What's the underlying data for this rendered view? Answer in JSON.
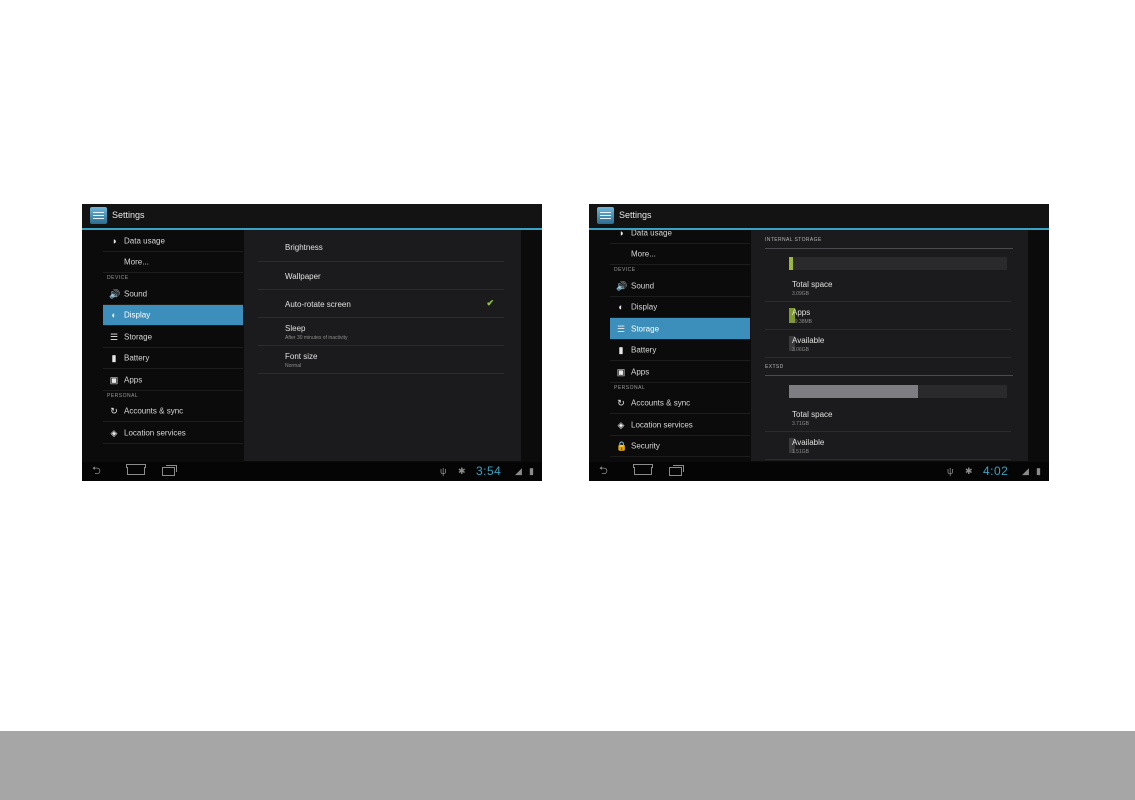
{
  "left_screen": {
    "app_title": "Settings",
    "sidebar": [
      {
        "label": "Data usage",
        "icon": "data-usage-icon",
        "glyph": "◑"
      },
      {
        "label": "More...",
        "icon": "",
        "glyph": ""
      },
      {
        "header": "DEVICE"
      },
      {
        "label": "Sound",
        "icon": "sound-icon",
        "glyph": "🔊"
      },
      {
        "label": "Display",
        "icon": "display-icon",
        "glyph": "◐",
        "selected": true
      },
      {
        "label": "Storage",
        "icon": "storage-icon",
        "glyph": "☰"
      },
      {
        "label": "Battery",
        "icon": "battery-icon",
        "glyph": "▮"
      },
      {
        "label": "Apps",
        "icon": "apps-icon",
        "glyph": "▣"
      },
      {
        "header": "PERSONAL"
      },
      {
        "label": "Accounts & sync",
        "icon": "sync-icon",
        "glyph": "↻"
      },
      {
        "label": "Location services",
        "icon": "location-icon",
        "glyph": "◈"
      }
    ],
    "display_settings": [
      {
        "title": "Brightness",
        "summary": ""
      },
      {
        "title": "Wallpaper",
        "summary": ""
      },
      {
        "title": "Auto-rotate screen",
        "summary": "",
        "checked": true
      },
      {
        "title": "Sleep",
        "summary": "After 30 minutes of inactivity"
      },
      {
        "title": "Font size",
        "summary": "Normal"
      }
    ],
    "clock": "3:54"
  },
  "right_screen": {
    "app_title": "Settings",
    "sidebar": [
      {
        "label": "Data usage",
        "icon": "data-usage-icon",
        "glyph": "◑"
      },
      {
        "label": "More...",
        "icon": "",
        "glyph": ""
      },
      {
        "header": "DEVICE"
      },
      {
        "label": "Sound",
        "icon": "sound-icon",
        "glyph": "🔊"
      },
      {
        "label": "Display",
        "icon": "display-icon",
        "glyph": "◐"
      },
      {
        "label": "Storage",
        "icon": "storage-icon",
        "glyph": "☰",
        "selected": true
      },
      {
        "label": "Battery",
        "icon": "battery-icon",
        "glyph": "▮"
      },
      {
        "label": "Apps",
        "icon": "apps-icon",
        "glyph": "▣"
      },
      {
        "header": "PERSONAL"
      },
      {
        "label": "Accounts & sync",
        "icon": "sync-icon",
        "glyph": "↻"
      },
      {
        "label": "Location services",
        "icon": "location-icon",
        "glyph": "◈"
      },
      {
        "label": "Security",
        "icon": "lock-icon",
        "glyph": "🔒"
      }
    ],
    "storage": {
      "internal_header": "INTERNAL STORAGE",
      "internal_usage_fraction": 0.01,
      "internal_items": [
        {
          "title": "Total space",
          "value": "3.09GB",
          "swatch": ""
        },
        {
          "title": "Apps",
          "value": "29.38MB",
          "swatch": "#7e9a2c"
        },
        {
          "title": "Available",
          "value": "3.06GB",
          "swatch": "#3a3a3d"
        }
      ],
      "ext_header": "EXTSD",
      "ext_usage_fraction": 0.59,
      "ext_items": [
        {
          "title": "Total space",
          "value": "3.71GB",
          "swatch": ""
        },
        {
          "title": "Available",
          "value": "1.51GB",
          "swatch": "#3a3a3d"
        }
      ]
    },
    "clock": "4:02"
  },
  "colors": {
    "accent": "#3aa3c4",
    "selected_row": "#3c8fbb",
    "check": "#8ec63e",
    "internal_bar_fill": "#9cb83a",
    "ext_bar_fill": "#7d7d82"
  }
}
